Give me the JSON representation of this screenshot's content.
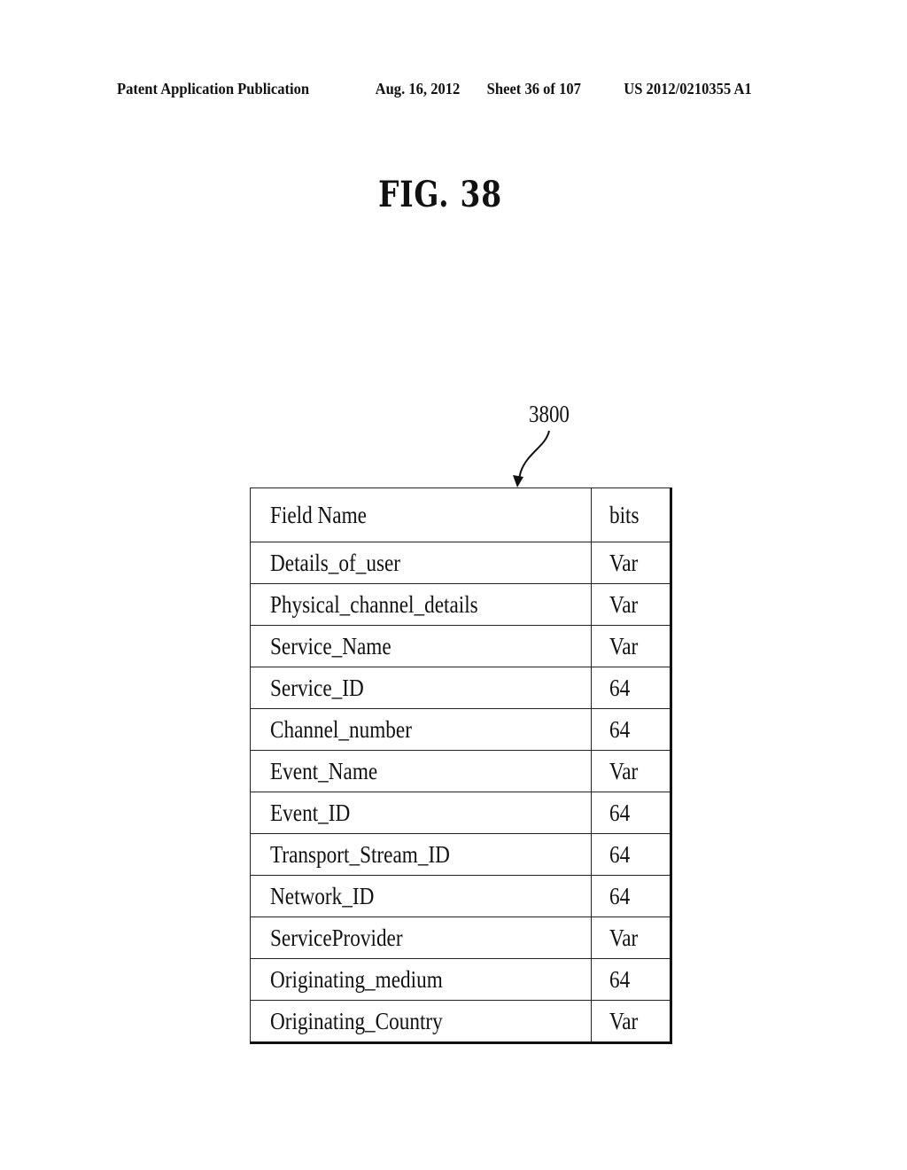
{
  "header": {
    "publication": "Patent Application Publication",
    "date": "Aug. 16, 2012",
    "sheet": "Sheet 36 of 107",
    "number": "US 2012/0210355 A1"
  },
  "figure": {
    "title": "FIG. 38",
    "reference": "3800"
  },
  "table": {
    "columns": [
      "Field Name",
      "bits"
    ],
    "rows": [
      {
        "name": "Details_of_user",
        "bits": "Var"
      },
      {
        "name": "Physical_channel_details",
        "bits": "Var"
      },
      {
        "name": "Service_Name",
        "bits": "Var"
      },
      {
        "name": "Service_ID",
        "bits": "64"
      },
      {
        "name": "Channel_number",
        "bits": "64"
      },
      {
        "name": "Event_Name",
        "bits": "Var"
      },
      {
        "name": "Event_ID",
        "bits": "64"
      },
      {
        "name": "Transport_Stream_ID",
        "bits": "64"
      },
      {
        "name": "Network_ID",
        "bits": "64"
      },
      {
        "name": "ServiceProvider",
        "bits": "Var"
      },
      {
        "name": "Originating_medium",
        "bits": "64"
      },
      {
        "name": "Originating_Country",
        "bits": "Var"
      }
    ]
  }
}
